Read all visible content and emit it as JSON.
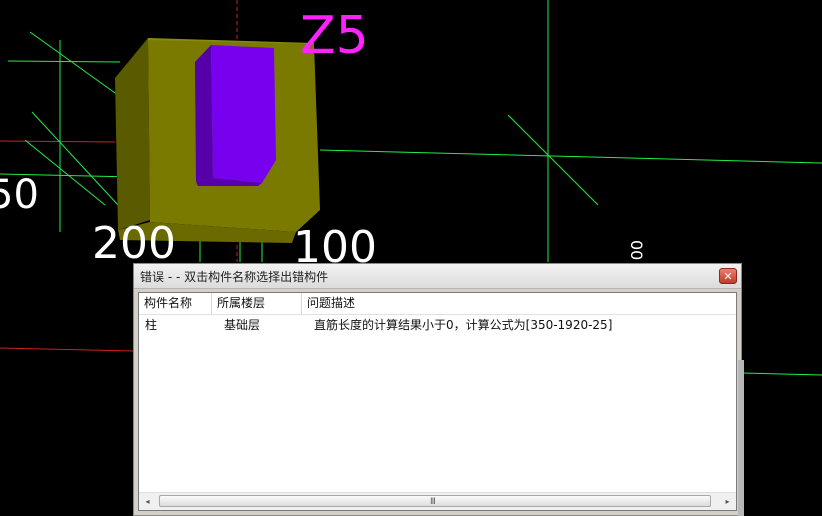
{
  "viewport": {
    "label_z5": "Z5",
    "label_200": "200",
    "label_100": "100",
    "label_left": "50",
    "label_right": "00",
    "colors": {
      "background": "#000000",
      "column_olive": "#7a7a00",
      "column_purple": "#7700ee",
      "axis_green": "#22ee44",
      "axis_red": "#cc2222",
      "label_magenta": "#ff22ff"
    }
  },
  "dialog": {
    "title": "错误 -  - 双击构件名称选择出错构件",
    "close_icon": "close-icon",
    "columns": [
      "构件名称",
      "所属楼层",
      "问题描述"
    ],
    "rows": [
      {
        "name": "柱",
        "floor": "基础层",
        "desc": "直筋长度的计算结果小于0，计算公式为[350-1920-25]"
      }
    ],
    "scroll_left": "◂",
    "scroll_right": "▸",
    "scroll_grip": "III"
  }
}
